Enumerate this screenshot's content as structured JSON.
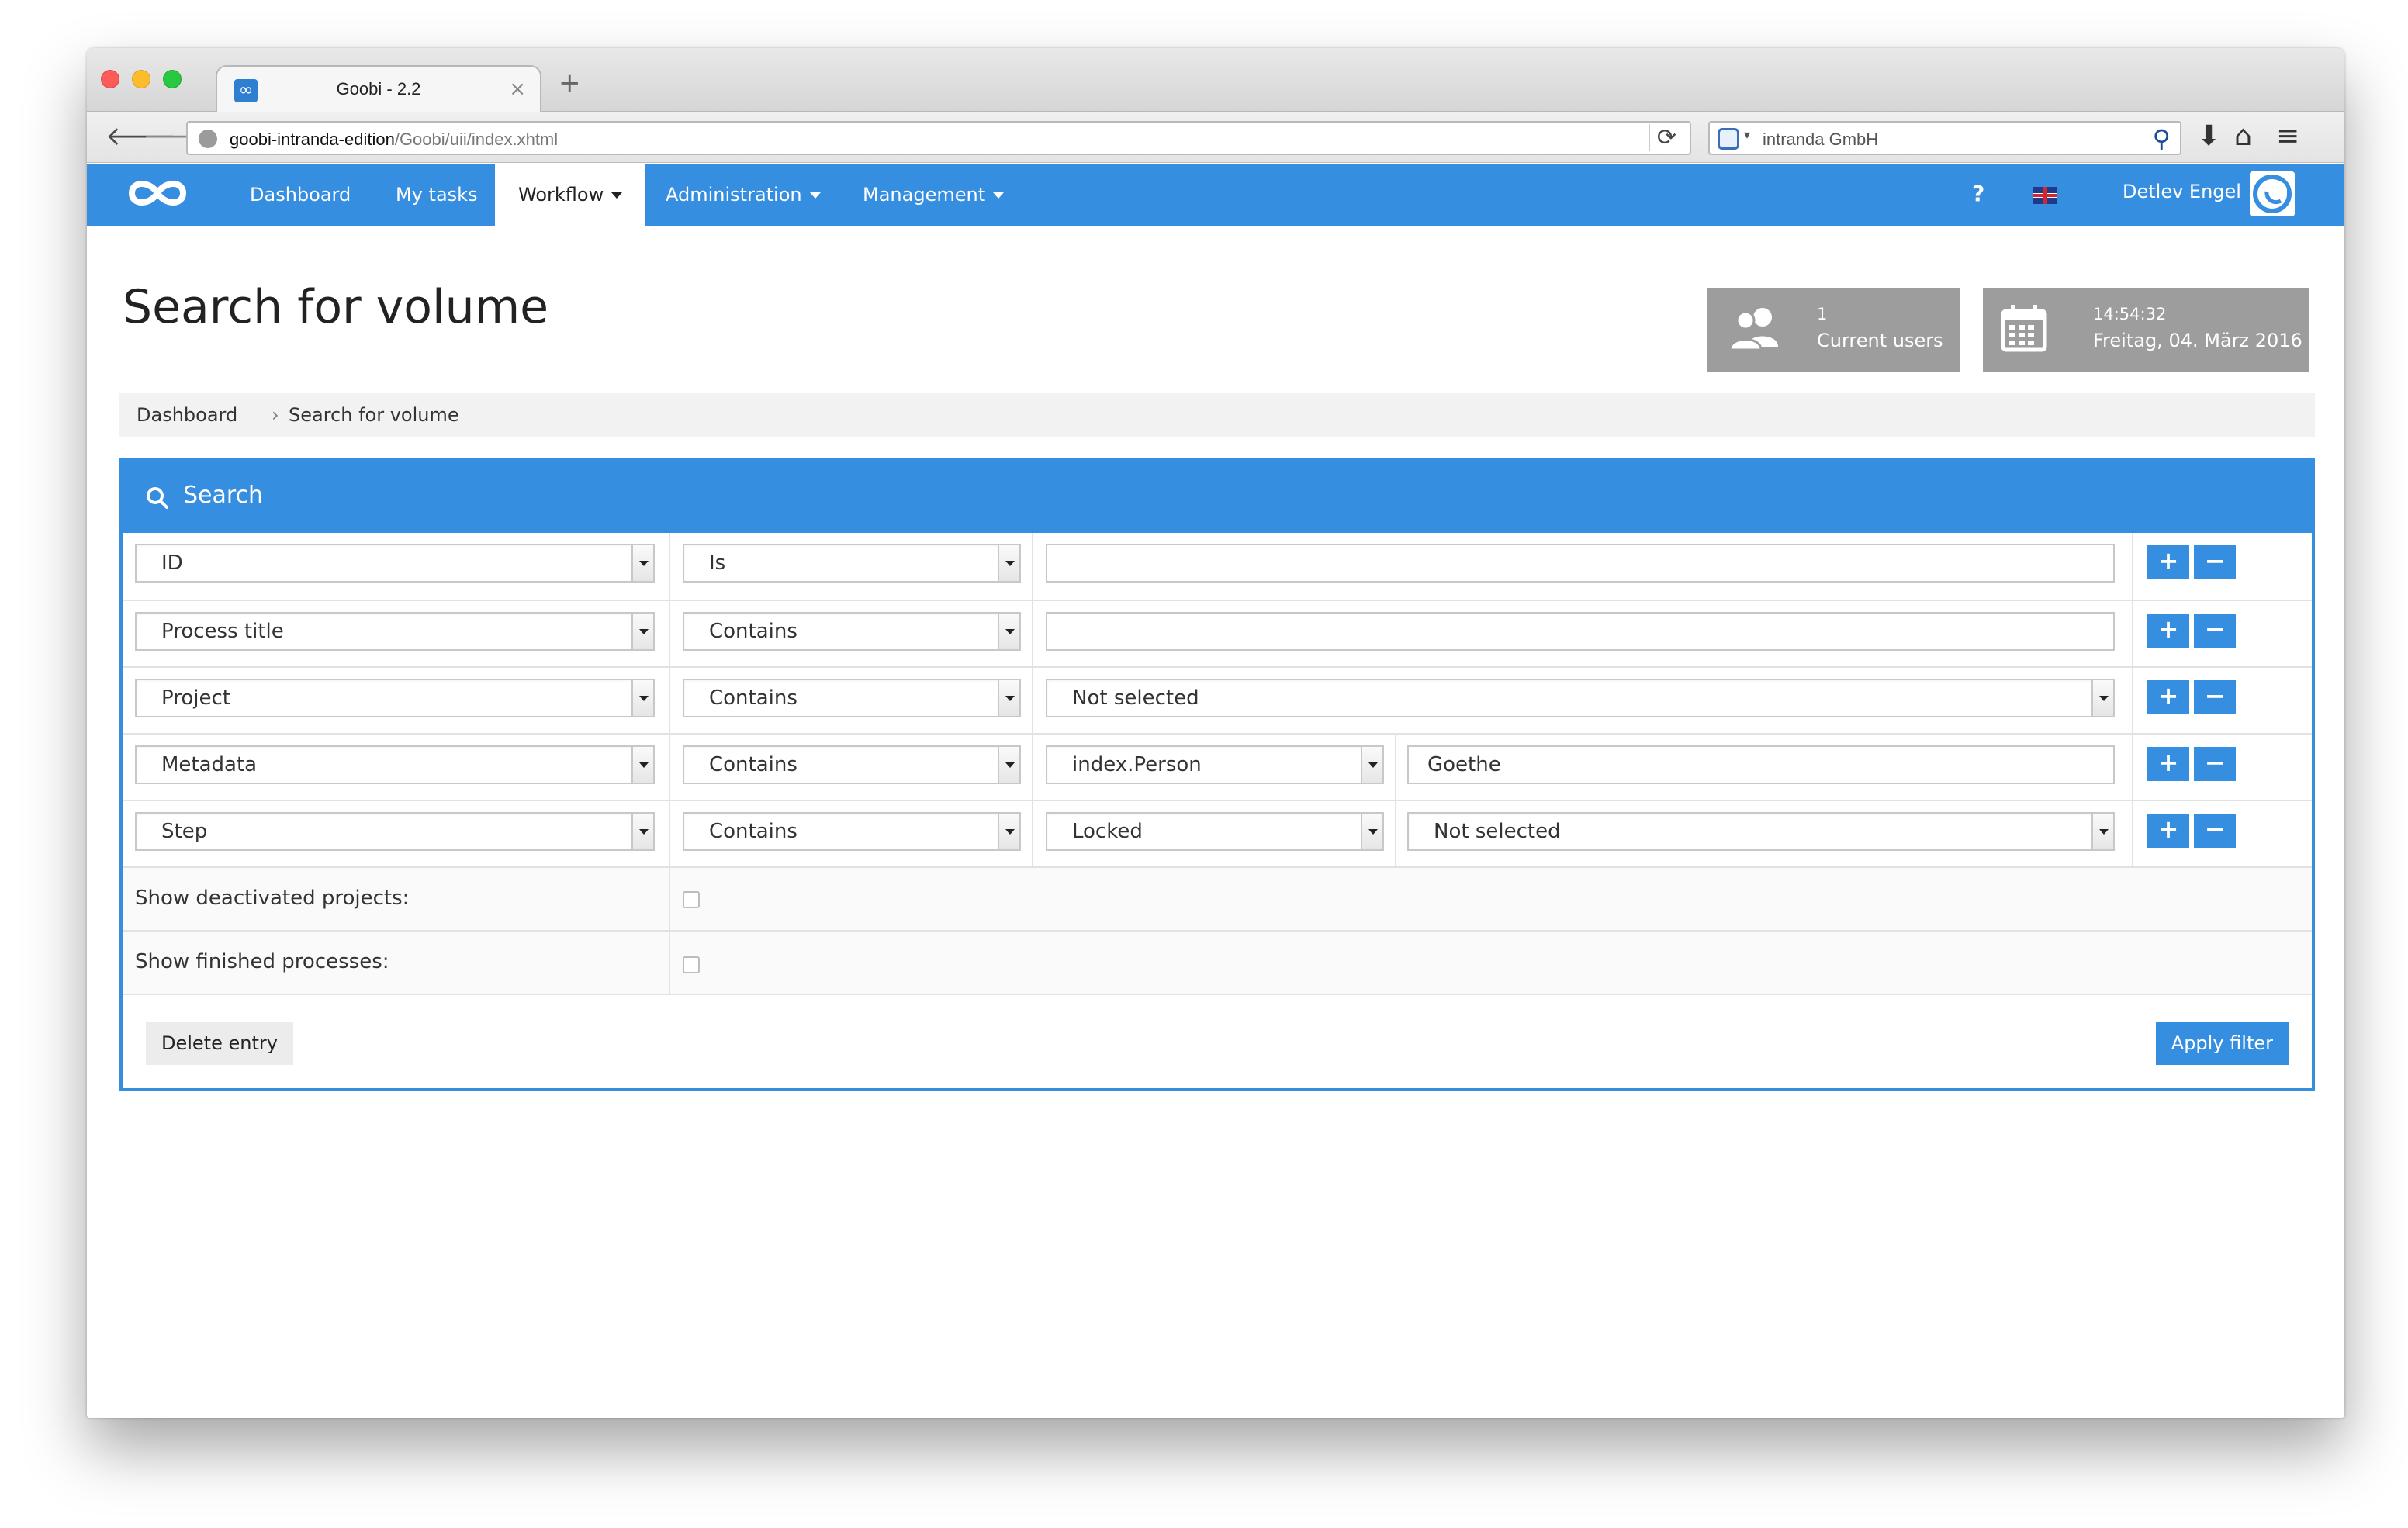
{
  "browser": {
    "tab_title": "Goobi - 2.2",
    "tab_close": "×",
    "new_tab": "+",
    "url_host": "goobi-intranda-edition",
    "url_path": "/Goobi/uii/index.xhtml",
    "search_engine_text": "intranda GmbH"
  },
  "navbar": {
    "items": [
      {
        "label": "Dashboard"
      },
      {
        "label": "My tasks"
      },
      {
        "label": "Workflow"
      },
      {
        "label": "Administration"
      },
      {
        "label": "Management"
      }
    ],
    "active": "Workflow",
    "help_label": "?",
    "user_name": "Detlev Engel"
  },
  "header": {
    "title": "Search for volume",
    "current_users_count": "1",
    "current_users_label": "Current users",
    "time": "14:54:32",
    "date": "Freitag, 04. März 2016"
  },
  "breadcrumb": {
    "items": [
      "Dashboard",
      "Search for volume"
    ],
    "separator": "›"
  },
  "panel": {
    "title": "Search",
    "rows": [
      {
        "field": "ID",
        "operator": "Is",
        "value": ""
      },
      {
        "field": "Process title",
        "operator": "Contains",
        "value": ""
      },
      {
        "field": "Project",
        "operator": "Contains",
        "value": "Not selected"
      },
      {
        "field": "Metadata",
        "operator": "Contains",
        "sub": "index.Person",
        "value": "Goethe"
      },
      {
        "field": "Step",
        "operator": "Contains",
        "sub": "Locked",
        "value": "Not selected"
      }
    ],
    "plus_label": "+",
    "minus_label": "−",
    "show_deactivated_label": "Show deactivated projects:",
    "show_finished_label": "Show finished processes:",
    "delete_label": "Delete entry",
    "apply_label": "Apply filter"
  },
  "colors": {
    "accent": "#368ee0",
    "stat_box": "#9d9d9d"
  }
}
